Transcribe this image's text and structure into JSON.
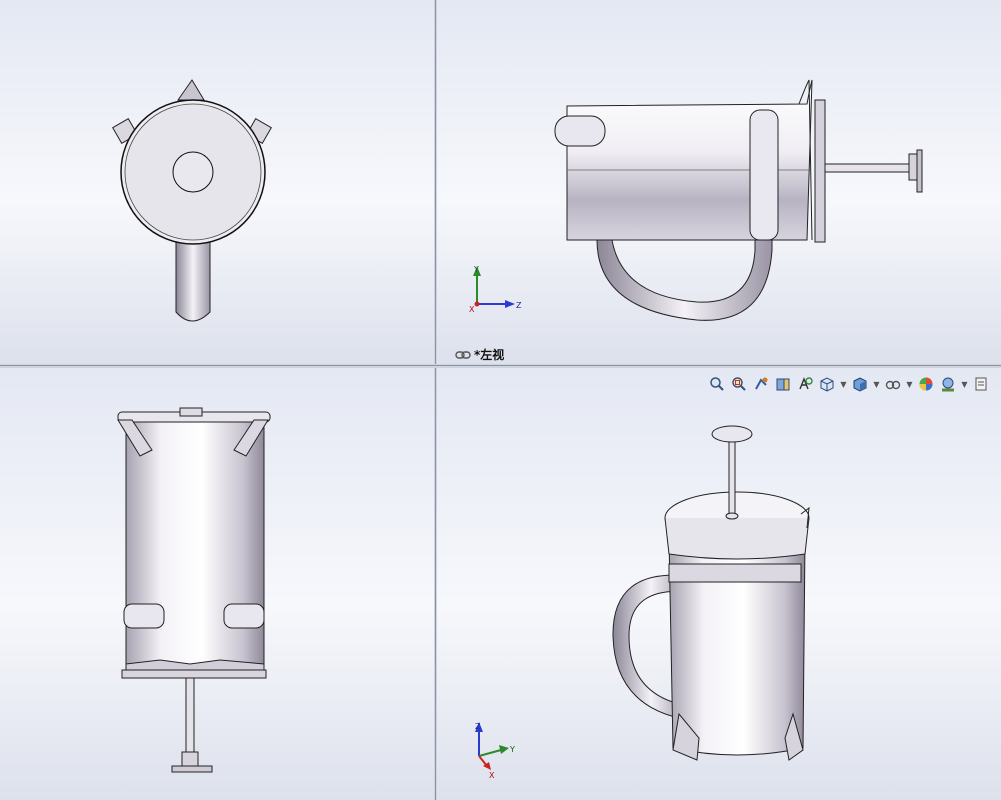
{
  "viewports": {
    "top_right": {
      "label": "*左视"
    },
    "top_right_triad": {
      "axis_v": "Y",
      "axis_h": "Z",
      "axis_o": "X"
    },
    "bottom_right_triad": {
      "axis_v": "Z",
      "axis_h": "Y",
      "axis_o": "X"
    }
  },
  "toolbar": {
    "items": [
      "zoom-to-fit-icon",
      "zoom-to-area-icon",
      "previous-view-icon",
      "section-view-icon",
      "dynamic-annotation-icon",
      "view-orientation-icon",
      "display-style-icon",
      "hide-show-items-icon",
      "edit-appearance-icon",
      "apply-scene-icon",
      "view-settings-icon"
    ]
  },
  "colors": {
    "background_top": "#e4e8f3",
    "background_mid": "#f7f8fc",
    "divider": "#8a93a6"
  }
}
